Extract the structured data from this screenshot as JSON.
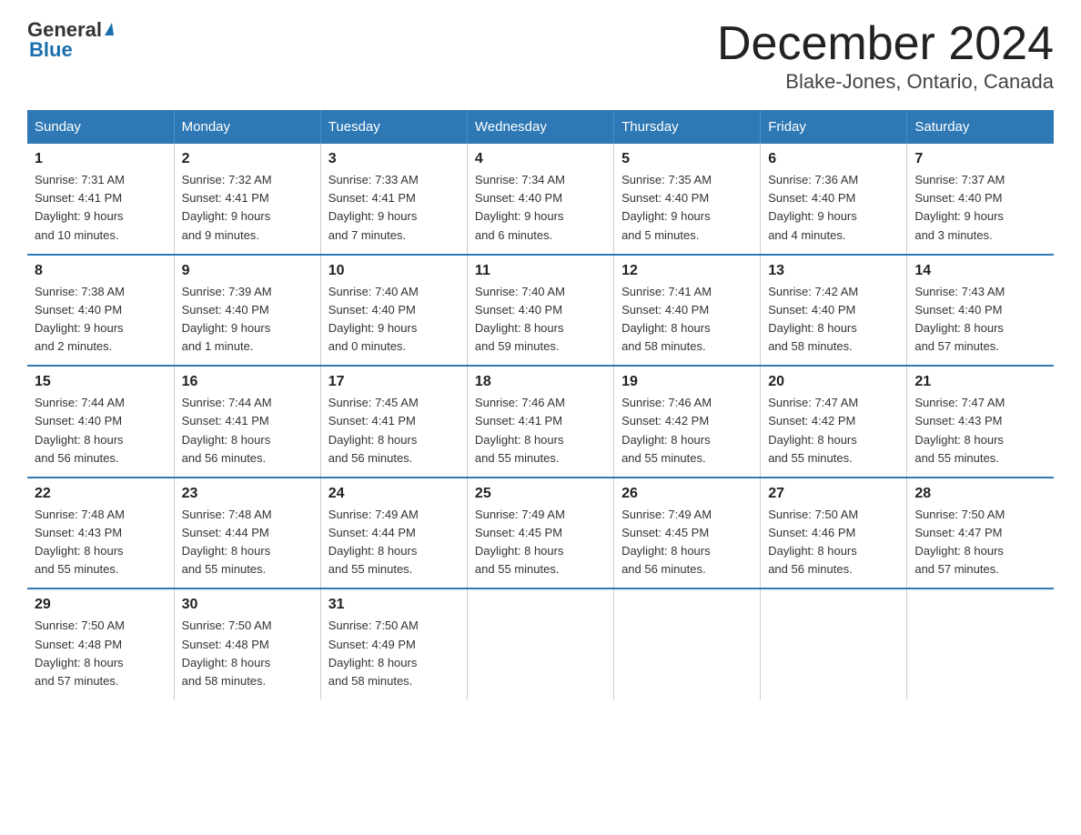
{
  "logo": {
    "line1": "General",
    "arrow": "▶",
    "line2": "Blue"
  },
  "title": "December 2024",
  "subtitle": "Blake-Jones, Ontario, Canada",
  "days_of_week": [
    "Sunday",
    "Monday",
    "Tuesday",
    "Wednesday",
    "Thursday",
    "Friday",
    "Saturday"
  ],
  "weeks": [
    [
      {
        "day": "1",
        "info": "Sunrise: 7:31 AM\nSunset: 4:41 PM\nDaylight: 9 hours\nand 10 minutes."
      },
      {
        "day": "2",
        "info": "Sunrise: 7:32 AM\nSunset: 4:41 PM\nDaylight: 9 hours\nand 9 minutes."
      },
      {
        "day": "3",
        "info": "Sunrise: 7:33 AM\nSunset: 4:41 PM\nDaylight: 9 hours\nand 7 minutes."
      },
      {
        "day": "4",
        "info": "Sunrise: 7:34 AM\nSunset: 4:40 PM\nDaylight: 9 hours\nand 6 minutes."
      },
      {
        "day": "5",
        "info": "Sunrise: 7:35 AM\nSunset: 4:40 PM\nDaylight: 9 hours\nand 5 minutes."
      },
      {
        "day": "6",
        "info": "Sunrise: 7:36 AM\nSunset: 4:40 PM\nDaylight: 9 hours\nand 4 minutes."
      },
      {
        "day": "7",
        "info": "Sunrise: 7:37 AM\nSunset: 4:40 PM\nDaylight: 9 hours\nand 3 minutes."
      }
    ],
    [
      {
        "day": "8",
        "info": "Sunrise: 7:38 AM\nSunset: 4:40 PM\nDaylight: 9 hours\nand 2 minutes."
      },
      {
        "day": "9",
        "info": "Sunrise: 7:39 AM\nSunset: 4:40 PM\nDaylight: 9 hours\nand 1 minute."
      },
      {
        "day": "10",
        "info": "Sunrise: 7:40 AM\nSunset: 4:40 PM\nDaylight: 9 hours\nand 0 minutes."
      },
      {
        "day": "11",
        "info": "Sunrise: 7:40 AM\nSunset: 4:40 PM\nDaylight: 8 hours\nand 59 minutes."
      },
      {
        "day": "12",
        "info": "Sunrise: 7:41 AM\nSunset: 4:40 PM\nDaylight: 8 hours\nand 58 minutes."
      },
      {
        "day": "13",
        "info": "Sunrise: 7:42 AM\nSunset: 4:40 PM\nDaylight: 8 hours\nand 58 minutes."
      },
      {
        "day": "14",
        "info": "Sunrise: 7:43 AM\nSunset: 4:40 PM\nDaylight: 8 hours\nand 57 minutes."
      }
    ],
    [
      {
        "day": "15",
        "info": "Sunrise: 7:44 AM\nSunset: 4:40 PM\nDaylight: 8 hours\nand 56 minutes."
      },
      {
        "day": "16",
        "info": "Sunrise: 7:44 AM\nSunset: 4:41 PM\nDaylight: 8 hours\nand 56 minutes."
      },
      {
        "day": "17",
        "info": "Sunrise: 7:45 AM\nSunset: 4:41 PM\nDaylight: 8 hours\nand 56 minutes."
      },
      {
        "day": "18",
        "info": "Sunrise: 7:46 AM\nSunset: 4:41 PM\nDaylight: 8 hours\nand 55 minutes."
      },
      {
        "day": "19",
        "info": "Sunrise: 7:46 AM\nSunset: 4:42 PM\nDaylight: 8 hours\nand 55 minutes."
      },
      {
        "day": "20",
        "info": "Sunrise: 7:47 AM\nSunset: 4:42 PM\nDaylight: 8 hours\nand 55 minutes."
      },
      {
        "day": "21",
        "info": "Sunrise: 7:47 AM\nSunset: 4:43 PM\nDaylight: 8 hours\nand 55 minutes."
      }
    ],
    [
      {
        "day": "22",
        "info": "Sunrise: 7:48 AM\nSunset: 4:43 PM\nDaylight: 8 hours\nand 55 minutes."
      },
      {
        "day": "23",
        "info": "Sunrise: 7:48 AM\nSunset: 4:44 PM\nDaylight: 8 hours\nand 55 minutes."
      },
      {
        "day": "24",
        "info": "Sunrise: 7:49 AM\nSunset: 4:44 PM\nDaylight: 8 hours\nand 55 minutes."
      },
      {
        "day": "25",
        "info": "Sunrise: 7:49 AM\nSunset: 4:45 PM\nDaylight: 8 hours\nand 55 minutes."
      },
      {
        "day": "26",
        "info": "Sunrise: 7:49 AM\nSunset: 4:45 PM\nDaylight: 8 hours\nand 56 minutes."
      },
      {
        "day": "27",
        "info": "Sunrise: 7:50 AM\nSunset: 4:46 PM\nDaylight: 8 hours\nand 56 minutes."
      },
      {
        "day": "28",
        "info": "Sunrise: 7:50 AM\nSunset: 4:47 PM\nDaylight: 8 hours\nand 57 minutes."
      }
    ],
    [
      {
        "day": "29",
        "info": "Sunrise: 7:50 AM\nSunset: 4:48 PM\nDaylight: 8 hours\nand 57 minutes."
      },
      {
        "day": "30",
        "info": "Sunrise: 7:50 AM\nSunset: 4:48 PM\nDaylight: 8 hours\nand 58 minutes."
      },
      {
        "day": "31",
        "info": "Sunrise: 7:50 AM\nSunset: 4:49 PM\nDaylight: 8 hours\nand 58 minutes."
      },
      {
        "day": "",
        "info": ""
      },
      {
        "day": "",
        "info": ""
      },
      {
        "day": "",
        "info": ""
      },
      {
        "day": "",
        "info": ""
      }
    ]
  ]
}
